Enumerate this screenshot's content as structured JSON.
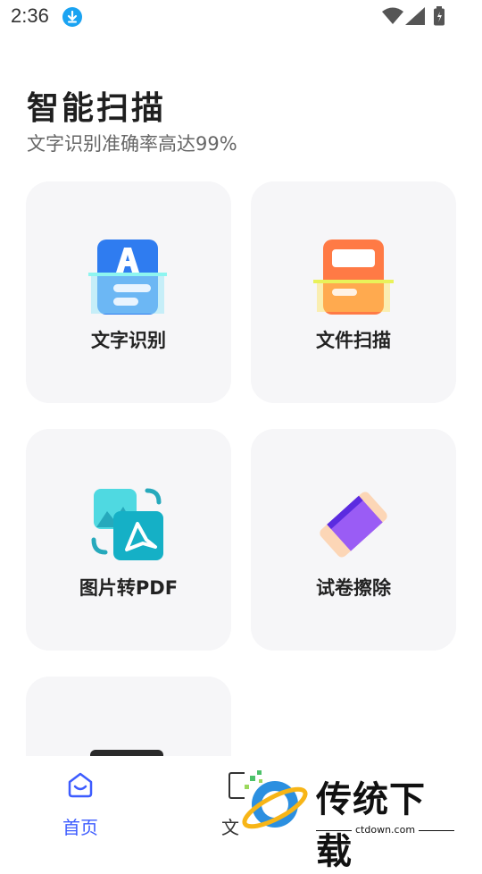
{
  "status_bar": {
    "time": "2:36",
    "icons": [
      "download-icon",
      "wifi-icon",
      "signal-icon",
      "battery-icon"
    ]
  },
  "header": {
    "title": "智能扫描",
    "subtitle": "文字识别准确率高达99%"
  },
  "cards": [
    {
      "label": "文字识别",
      "icon": "text-recognition-icon"
    },
    {
      "label": "文件扫描",
      "icon": "file-scan-icon"
    },
    {
      "label": "图片转PDF",
      "icon": "image-to-pdf-icon"
    },
    {
      "label": "试卷擦除",
      "icon": "eraser-icon"
    }
  ],
  "bottom_nav": {
    "items": [
      {
        "label": "首页",
        "icon": "home-icon",
        "active": true
      },
      {
        "label": "文",
        "icon": "document-icon",
        "active": false
      }
    ]
  },
  "watermark": {
    "text": "传统下载",
    "url": "ctdown.com"
  },
  "colors": {
    "accent": "#3d5cff",
    "card_bg": "#f6f6f8",
    "subtitle": "#666666"
  }
}
